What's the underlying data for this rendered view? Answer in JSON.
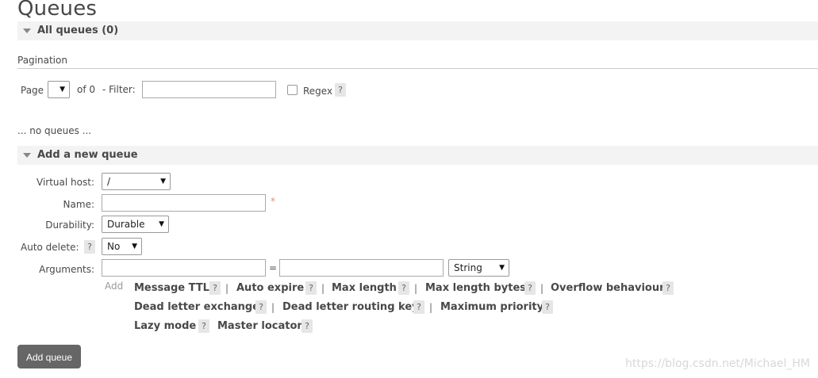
{
  "page": {
    "title": "Queues"
  },
  "all_queues": {
    "label": "All queues (0)"
  },
  "pagination": {
    "heading": "Pagination",
    "page_label": "Page",
    "page_value": "",
    "of_label": "of 0",
    "filter_label": "- Filter:",
    "filter_value": "",
    "regex_label": "Regex",
    "help": "?"
  },
  "empty_message": "... no queues ...",
  "add_queue": {
    "section_label": "Add a new queue",
    "virtual_host": {
      "label": "Virtual host:",
      "value": "/"
    },
    "name": {
      "label": "Name:",
      "value": "",
      "required_mark": "*"
    },
    "durability": {
      "label": "Durability:",
      "value": "Durable"
    },
    "auto_delete": {
      "label": "Auto delete:",
      "value": "No",
      "help": "?"
    },
    "arguments": {
      "label": "Arguments:",
      "key": "",
      "equals": "=",
      "value": "",
      "type": "String"
    },
    "add_label": "Add",
    "links": [
      "Message TTL",
      "Auto expire",
      "Max length",
      "Max length bytes",
      "Overflow behaviour",
      "Dead letter exchange",
      "Dead letter routing key",
      "Maximum priority",
      "Lazy mode",
      "Master locator"
    ],
    "separator": "|",
    "help": "?",
    "submit_label": "Add queue"
  },
  "watermark": "https://blog.csdn.net/Michael_HM",
  "icons": {
    "dropdown": "dropdown-arrow-icon",
    "collapse": "collapse-triangle-icon"
  }
}
